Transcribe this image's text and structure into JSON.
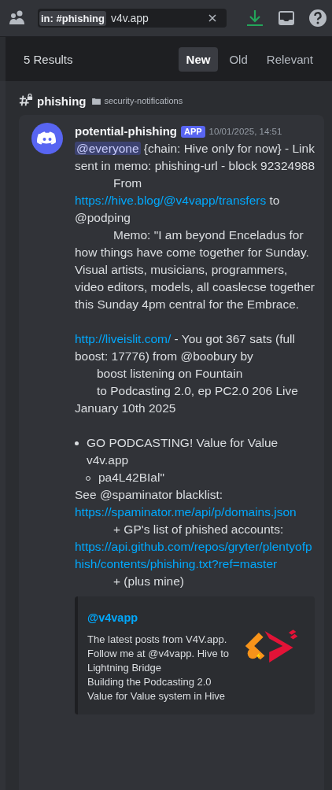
{
  "search": {
    "filter": "in: #phishing",
    "value": "v4v.app"
  },
  "results": {
    "count": "5 Results",
    "sort_tabs": [
      {
        "label": "New",
        "selected": true
      },
      {
        "label": "Old",
        "selected": false
      },
      {
        "label": "Relevant",
        "selected": false
      }
    ]
  },
  "channel": {
    "name": "phishing",
    "category": "security-notifications"
  },
  "message": {
    "author": "potential-phishing",
    "badge": "APP",
    "timestamp": "10/01/2025, 14:51",
    "lines": [
      {
        "kind": "plain",
        "parts": [
          {
            "kind": "mention",
            "text": "@everyone"
          },
          {
            "kind": "text",
            "text": " {chain: Hive only for now} - Link sent in memo: phishing-url - block 92324988"
          }
        ]
      },
      {
        "kind": "indent",
        "parts": [
          {
            "kind": "text",
            "text": "From"
          }
        ]
      },
      {
        "kind": "plain",
        "parts": [
          {
            "kind": "link",
            "text": "https://hive.blog/@v4vapp/transfers"
          },
          {
            "kind": "text",
            "text": " to @podping"
          }
        ]
      },
      {
        "kind": "indent",
        "parts": [
          {
            "kind": "text",
            "text": "Memo: \"I am beyond Enceladus for how things have come together for Sunday. Visual artists, musicians, programmers, video editors, models, all coaslecse together this Sunday 4pm central for the Embrace."
          }
        ]
      },
      {
        "kind": "gap"
      },
      {
        "kind": "plain",
        "parts": [
          {
            "kind": "link",
            "text": "http://liveislit.com/"
          },
          {
            "kind": "text",
            "text": " - You got 367 sats (full boost: 17776) from @boobury by"
          }
        ]
      },
      {
        "kind": "indent_small",
        "parts": [
          {
            "kind": "text",
            "text": "boost listening on Fountain"
          }
        ]
      },
      {
        "kind": "indent_small",
        "parts": [
          {
            "kind": "text",
            "text": "to Podcasting 2.0, ep PC2.0 206 Live January 10th 2025"
          }
        ]
      },
      {
        "kind": "gap"
      },
      {
        "kind": "bullet",
        "parts": [
          {
            "kind": "text",
            "text": "GO PODCASTING! Value for Value v4v.app"
          }
        ]
      },
      {
        "kind": "subbullet",
        "parts": [
          {
            "kind": "text",
            "text": "pa4L42BIal\""
          }
        ]
      },
      {
        "kind": "plain",
        "parts": [
          {
            "kind": "text",
            "text": "See @spaminator blacklist:"
          }
        ]
      },
      {
        "kind": "plain",
        "parts": [
          {
            "kind": "link",
            "text": "https://spaminator.me/api/p/domains.json"
          }
        ]
      },
      {
        "kind": "indent",
        "parts": [
          {
            "kind": "text",
            "text": "+ GP's list of phished accounts:"
          }
        ]
      },
      {
        "kind": "plain",
        "parts": [
          {
            "kind": "link",
            "text": "https://api.github.com/repos/gryter/plentyofphish/contents/phishing.txt?ref=master"
          }
        ]
      },
      {
        "kind": "indent",
        "parts": [
          {
            "kind": "text",
            "text": "+ (plus mine)"
          }
        ]
      }
    ],
    "embed": {
      "title": "@v4vapp",
      "description": [
        "The latest posts from V4V.app. Follow me at @v4vapp. Hive to Lightning Bridge",
        "Building the Podcasting 2.0 Value for Value system in Hive"
      ]
    }
  }
}
